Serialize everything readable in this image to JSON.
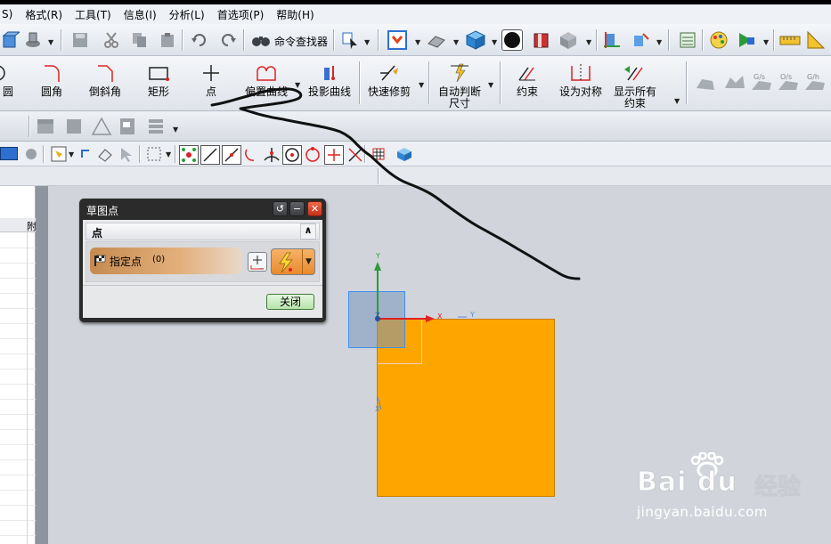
{
  "menubar": {
    "items": [
      "S)",
      "格式(R)",
      "工具(T)",
      "信息(I)",
      "分析(L)",
      "首选项(P)",
      "帮助(H)"
    ]
  },
  "toolbar1": {
    "command_finder_label": "命令查找器"
  },
  "sketch_toolbar": {
    "items": [
      {
        "label": "圆",
        "icon": "circle-icon"
      },
      {
        "label": "圆角",
        "icon": "fillet-icon"
      },
      {
        "label": "倒斜角",
        "icon": "chamfer-icon"
      },
      {
        "label": "矩形",
        "icon": "rectangle-icon"
      },
      {
        "label": "点",
        "icon": "point-icon"
      },
      {
        "label": "偏置曲线",
        "icon": "offset-curve-icon"
      },
      {
        "label": "投影曲线",
        "icon": "project-curve-icon"
      },
      {
        "label": "快速修剪",
        "icon": "quick-trim-icon"
      },
      {
        "label": "自动判断",
        "label2": "尺寸",
        "icon": "dimension-icon"
      },
      {
        "label": "约束",
        "icon": "constraint-icon"
      },
      {
        "label": "设为对称",
        "icon": "symmetric-icon"
      },
      {
        "label": "显示所有",
        "label2": "约束",
        "icon": "show-constraints-icon"
      }
    ]
  },
  "navigator": {
    "column_header": "附"
  },
  "dialog": {
    "title": "草图点",
    "group_title": "点",
    "specify_point_label": "指定点",
    "specify_point_count": "(0)",
    "close_button": "关闭"
  },
  "viewport": {
    "axis_x": "X",
    "axis_y": "Y",
    "axis_z": "Z",
    "axis_y2": "Y",
    "axis_x2": "X"
  },
  "watermark": {
    "brand": "Bai du",
    "product": "经验",
    "url": "jingyan.baidu.com"
  },
  "colors": {
    "orange_square": "#ffa500",
    "dialog_title_bg": "#2b2b2b",
    "close_button_bg": "#c8ecbf"
  }
}
